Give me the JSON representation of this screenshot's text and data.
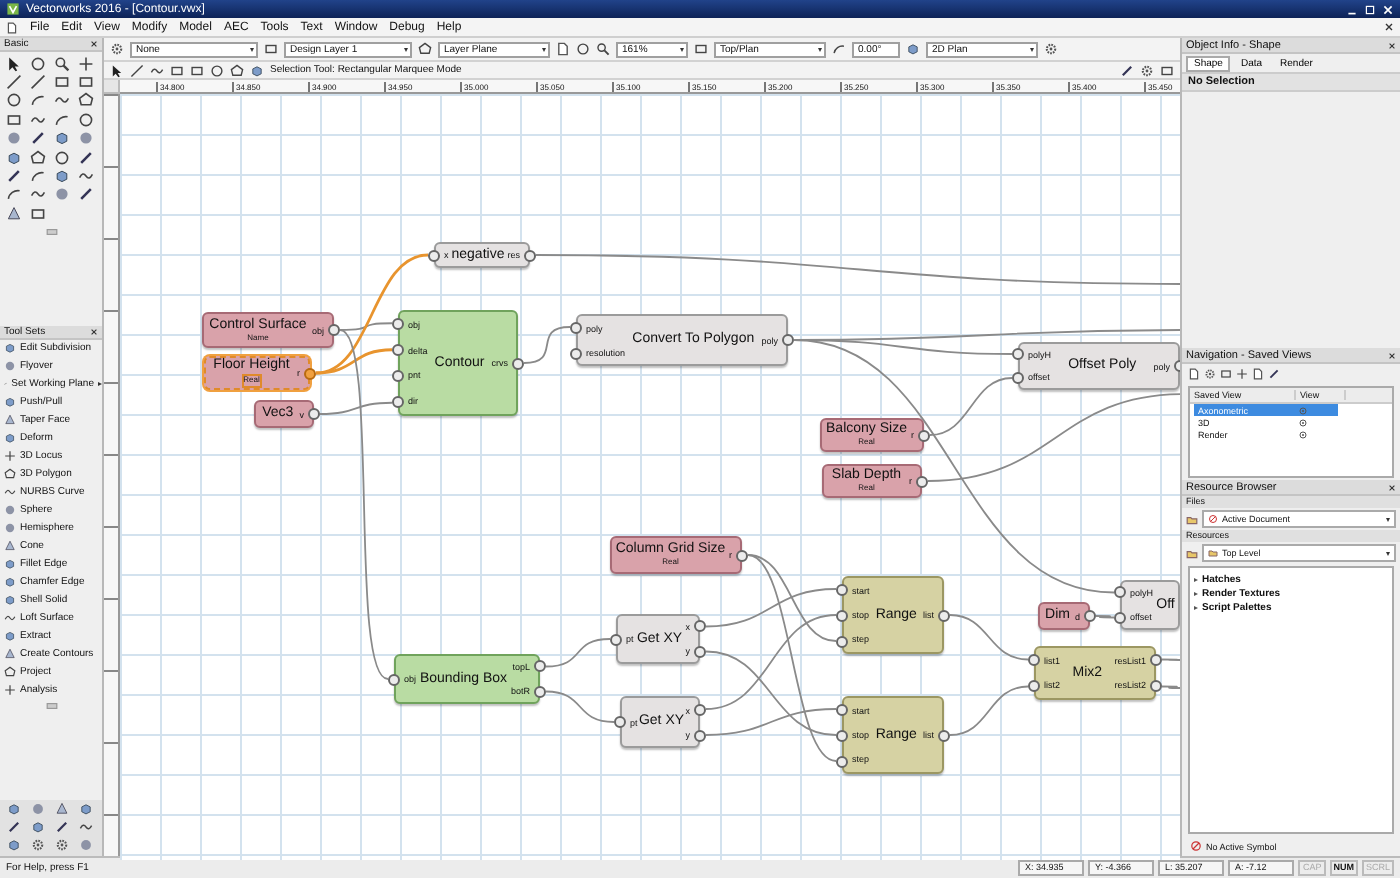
{
  "window": {
    "title": "Vectorworks 2016 - [Contour.vwx]"
  },
  "menu": [
    "File",
    "Edit",
    "View",
    "Modify",
    "Model",
    "AEC",
    "Tools",
    "Text",
    "Window",
    "Debug",
    "Help"
  ],
  "basic_palette": {
    "title": "Basic"
  },
  "tool_sets": {
    "title": "Tool Sets",
    "items": [
      {
        "label": "Edit Subdivision",
        "has_submenu": false
      },
      {
        "label": "Flyover",
        "has_submenu": false
      },
      {
        "label": "Set Working Plane",
        "has_submenu": true
      },
      {
        "label": "Push/Pull",
        "has_submenu": false
      },
      {
        "label": "Taper Face",
        "has_submenu": false
      },
      {
        "label": "Deform",
        "has_submenu": false
      },
      {
        "label": "3D Locus",
        "has_submenu": false
      },
      {
        "label": "3D Polygon",
        "has_submenu": false
      },
      {
        "label": "NURBS Curve",
        "has_submenu": false
      },
      {
        "label": "Sphere",
        "has_submenu": false
      },
      {
        "label": "Hemisphere",
        "has_submenu": false
      },
      {
        "label": "Cone",
        "has_submenu": false
      },
      {
        "label": "Fillet Edge",
        "has_submenu": false
      },
      {
        "label": "Chamfer Edge",
        "has_submenu": false
      },
      {
        "label": "Shell Solid",
        "has_submenu": false
      },
      {
        "label": "Loft Surface",
        "has_submenu": false
      },
      {
        "label": "Extract",
        "has_submenu": false
      },
      {
        "label": "Create Contours",
        "has_submenu": false
      },
      {
        "label": "Project",
        "has_submenu": false
      },
      {
        "label": "Analysis",
        "has_submenu": false
      }
    ]
  },
  "view_bar": {
    "class": "None",
    "layer": "Design Layer 1",
    "plane": "Layer Plane",
    "zoom": "161%",
    "view": "Top/Plan",
    "rotation": "0.00°",
    "render": "2D Plan"
  },
  "mode_bar": {
    "message": "Selection Tool: Rectangular Marquee Mode"
  },
  "ruler": {
    "labels": [
      "34.800",
      "34.850",
      "34.900",
      "34.950",
      "35.000",
      "35.050",
      "35.100",
      "35.150",
      "35.200",
      "35.250",
      "35.300",
      "35.350",
      "35.400",
      "35.450"
    ]
  },
  "graph": {
    "nodes": [
      {
        "kind": "math",
        "title": "negative",
        "inputs": [
          "x"
        ],
        "outputs": [
          "res"
        ],
        "selected": false
      },
      {
        "kind": "parameter",
        "title": "Control Surface",
        "subtitle": "Name",
        "outputs": [
          "obj"
        ],
        "selected": false
      },
      {
        "kind": "parameter",
        "title": "Floor Height",
        "subtitle": "Real",
        "outputs": [
          "r"
        ],
        "selected": true
      },
      {
        "kind": "parameter",
        "title": "Vec3",
        "outputs": [
          "v"
        ],
        "selected": false
      },
      {
        "kind": "geometry",
        "title": "Contour",
        "inputs": [
          "obj",
          "delta",
          "pnt",
          "dir"
        ],
        "outputs": [
          "crvs"
        ],
        "selected": false
      },
      {
        "kind": "math",
        "title": "Convert To Polygon",
        "inputs": [
          "poly",
          "resolution"
        ],
        "outputs": [
          "poly"
        ],
        "selected": false
      },
      {
        "kind": "math",
        "title": "Offset Poly",
        "inputs": [
          "polyH",
          "offset"
        ],
        "outputs": [
          "poly"
        ],
        "selected": false
      },
      {
        "kind": "parameter",
        "title": "Balcony Size",
        "subtitle": "Real",
        "outputs": [
          "r"
        ],
        "selected": false
      },
      {
        "kind": "parameter",
        "title": "Slab Depth",
        "subtitle": "Real",
        "outputs": [
          "r"
        ],
        "selected": false
      },
      {
        "kind": "parameter",
        "title": "Column Grid Size",
        "subtitle": "Real",
        "outputs": [
          "r"
        ],
        "selected": false
      },
      {
        "kind": "geometry",
        "title": "Bounding Box",
        "inputs": [
          "obj"
        ],
        "outputs": [
          "topL",
          "botR"
        ],
        "selected": false
      },
      {
        "kind": "math",
        "title": "Get XY",
        "inputs": [
          "pt"
        ],
        "outputs": [
          "x",
          "y"
        ],
        "selected": false
      },
      {
        "kind": "math",
        "title": "Get XY",
        "inputs": [
          "pt"
        ],
        "outputs": [
          "x",
          "y"
        ],
        "selected": false
      },
      {
        "kind": "list",
        "title": "Range",
        "inputs": [
          "start",
          "stop",
          "step"
        ],
        "outputs": [
          "list"
        ],
        "selected": false
      },
      {
        "kind": "list",
        "title": "Range",
        "inputs": [
          "start",
          "stop",
          "step"
        ],
        "outputs": [
          "list"
        ],
        "selected": false
      },
      {
        "kind": "parameter",
        "title": "Dim",
        "outputs": [
          "d"
        ],
        "selected": false
      },
      {
        "kind": "math",
        "title": "Off",
        "inputs": [
          "polyH",
          "offset"
        ],
        "selected": false
      },
      {
        "kind": "list",
        "title": "Mix2",
        "inputs": [
          "list1",
          "list2"
        ],
        "outputs": [
          "resList1",
          "resList2"
        ],
        "selected": false
      }
    ]
  },
  "object_info": {
    "title": "Object Info - Shape",
    "tabs": [
      {
        "label": "Shape",
        "selected": true
      },
      {
        "label": "Data",
        "selected": false
      },
      {
        "label": "Render",
        "selected": false
      }
    ],
    "selection": "No Selection"
  },
  "navigation": {
    "title": "Navigation - Saved Views",
    "columns": [
      "Saved View",
      "View"
    ],
    "rows": [
      {
        "name": "Axonometric",
        "selected": true
      },
      {
        "name": "3D",
        "selected": false
      },
      {
        "name": "Render",
        "selected": false
      }
    ]
  },
  "resource_browser": {
    "title": "Resource Browser",
    "files_label": "Files",
    "file": "Active Document",
    "resources_label": "Resources",
    "folder": "Top Level",
    "folders": [
      {
        "label": "Hatches",
        "expanded": false
      },
      {
        "label": "Render Textures",
        "expanded": false
      },
      {
        "label": "Script Palettes",
        "expanded": false
      }
    ],
    "symbol": "No Active Symbol"
  },
  "status_bar": {
    "help": "For Help, press F1",
    "coords": [
      "X: 34.935",
      "Y: -4.366",
      "L: 35.207",
      "A: -7.12"
    ],
    "keys": [
      {
        "label": "CAP",
        "on": false
      },
      {
        "label": "NUM",
        "on": true
      },
      {
        "label": "SCRL",
        "on": false
      }
    ]
  }
}
